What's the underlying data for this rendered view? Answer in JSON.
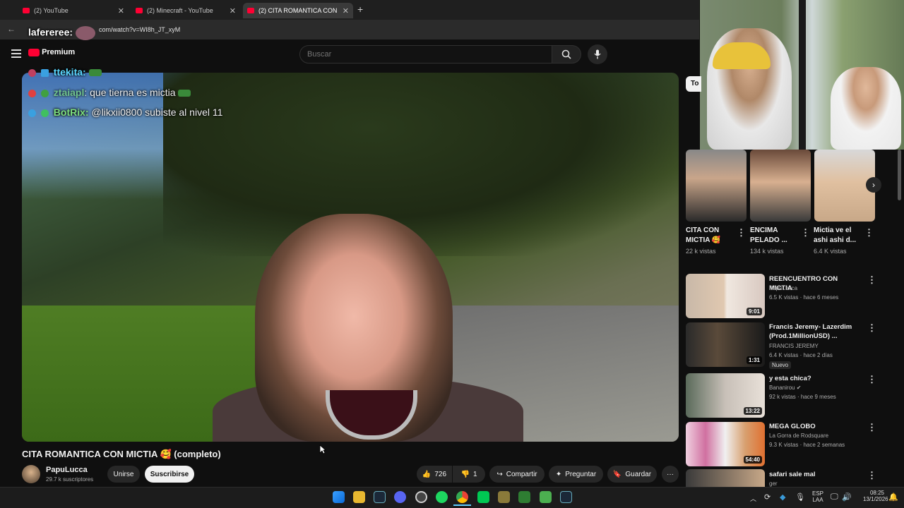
{
  "browser": {
    "tabs": [
      {
        "label": "(2) YouTube"
      },
      {
        "label": "(2) Minecraft - YouTube"
      },
      {
        "label": "(2) CITA ROMANTICA CON"
      }
    ],
    "new_tab_label": "+",
    "url": "com/watch?v=WI8h_JT_xyM"
  },
  "youtube": {
    "search_placeholder": "Buscar",
    "premium_label": "Premium"
  },
  "chat_overlay": [
    {
      "user": "lafereree:",
      "text": ""
    },
    {
      "user": "ttekita:",
      "text": ""
    },
    {
      "user": "ztaiapl",
      "text": ": que tierna es mictia"
    },
    {
      "user": "BotRix:",
      "text": "@likxii0800 subiste al nivel 11"
    }
  ],
  "video": {
    "title": "CITA ROMANTICA CON MICTIA 🥰 (completo)",
    "channel": "PapuLucca",
    "subscribers": "29.7 k suscriptores",
    "join_label": "Unirse",
    "subscribe_label": "Suscribirse",
    "likes": "726",
    "dislikes": "1",
    "share_label": "Compartir",
    "ask_label": "Preguntar",
    "save_label": "Guardar",
    "more_label": "···"
  },
  "sidebar": {
    "chip_label": "To",
    "shorts": [
      {
        "title": "CITA CON MICTIA 🥰",
        "views": "22 k vistas"
      },
      {
        "title": "ENCIMA PELADO ...",
        "views": "134 k vistas"
      },
      {
        "title": "Mictia ve el ashi ashi d...",
        "views": "6.4 K vistas"
      }
    ],
    "next_label": "›",
    "recommended": [
      {
        "title": "REENCUENTRO CON MICTIA",
        "channel": "PapuLucca",
        "meta": "6.5 K vistas · hace 6 meses",
        "duration": "9:01",
        "badge": ""
      },
      {
        "title": "Francis Jeremy- Lazerdim (Prod.1MillionUSD) ...",
        "channel": "FRANCIS JEREMY",
        "meta": "6.4 K vistas · hace 2 días",
        "duration": "1:31",
        "badge": "Nuevo"
      },
      {
        "title": "y esta chica?",
        "channel": "Bananirou",
        "meta": "92 k vistas · hace 9 meses",
        "duration": "13:22",
        "badge": ""
      },
      {
        "title": "MEGA GLOBO",
        "channel": "La Gorra de Rodsquare",
        "meta": "9.3 K vistas · hace 2 semanas",
        "duration": "54:40",
        "badge": ""
      },
      {
        "title": "safari sale mal",
        "channel": "ger",
        "meta": "",
        "duration": "",
        "badge": ""
      }
    ]
  },
  "taskbar": {
    "language": "ESP",
    "language_sub": "LAA",
    "time": "08:25",
    "date": "13/1/2026"
  },
  "colors": {
    "background": "#0f0f0f",
    "youtube_red": "#ff0033",
    "chat_user_green": "#7ee07e",
    "chat_user_cyan": "#5ad8ff"
  }
}
